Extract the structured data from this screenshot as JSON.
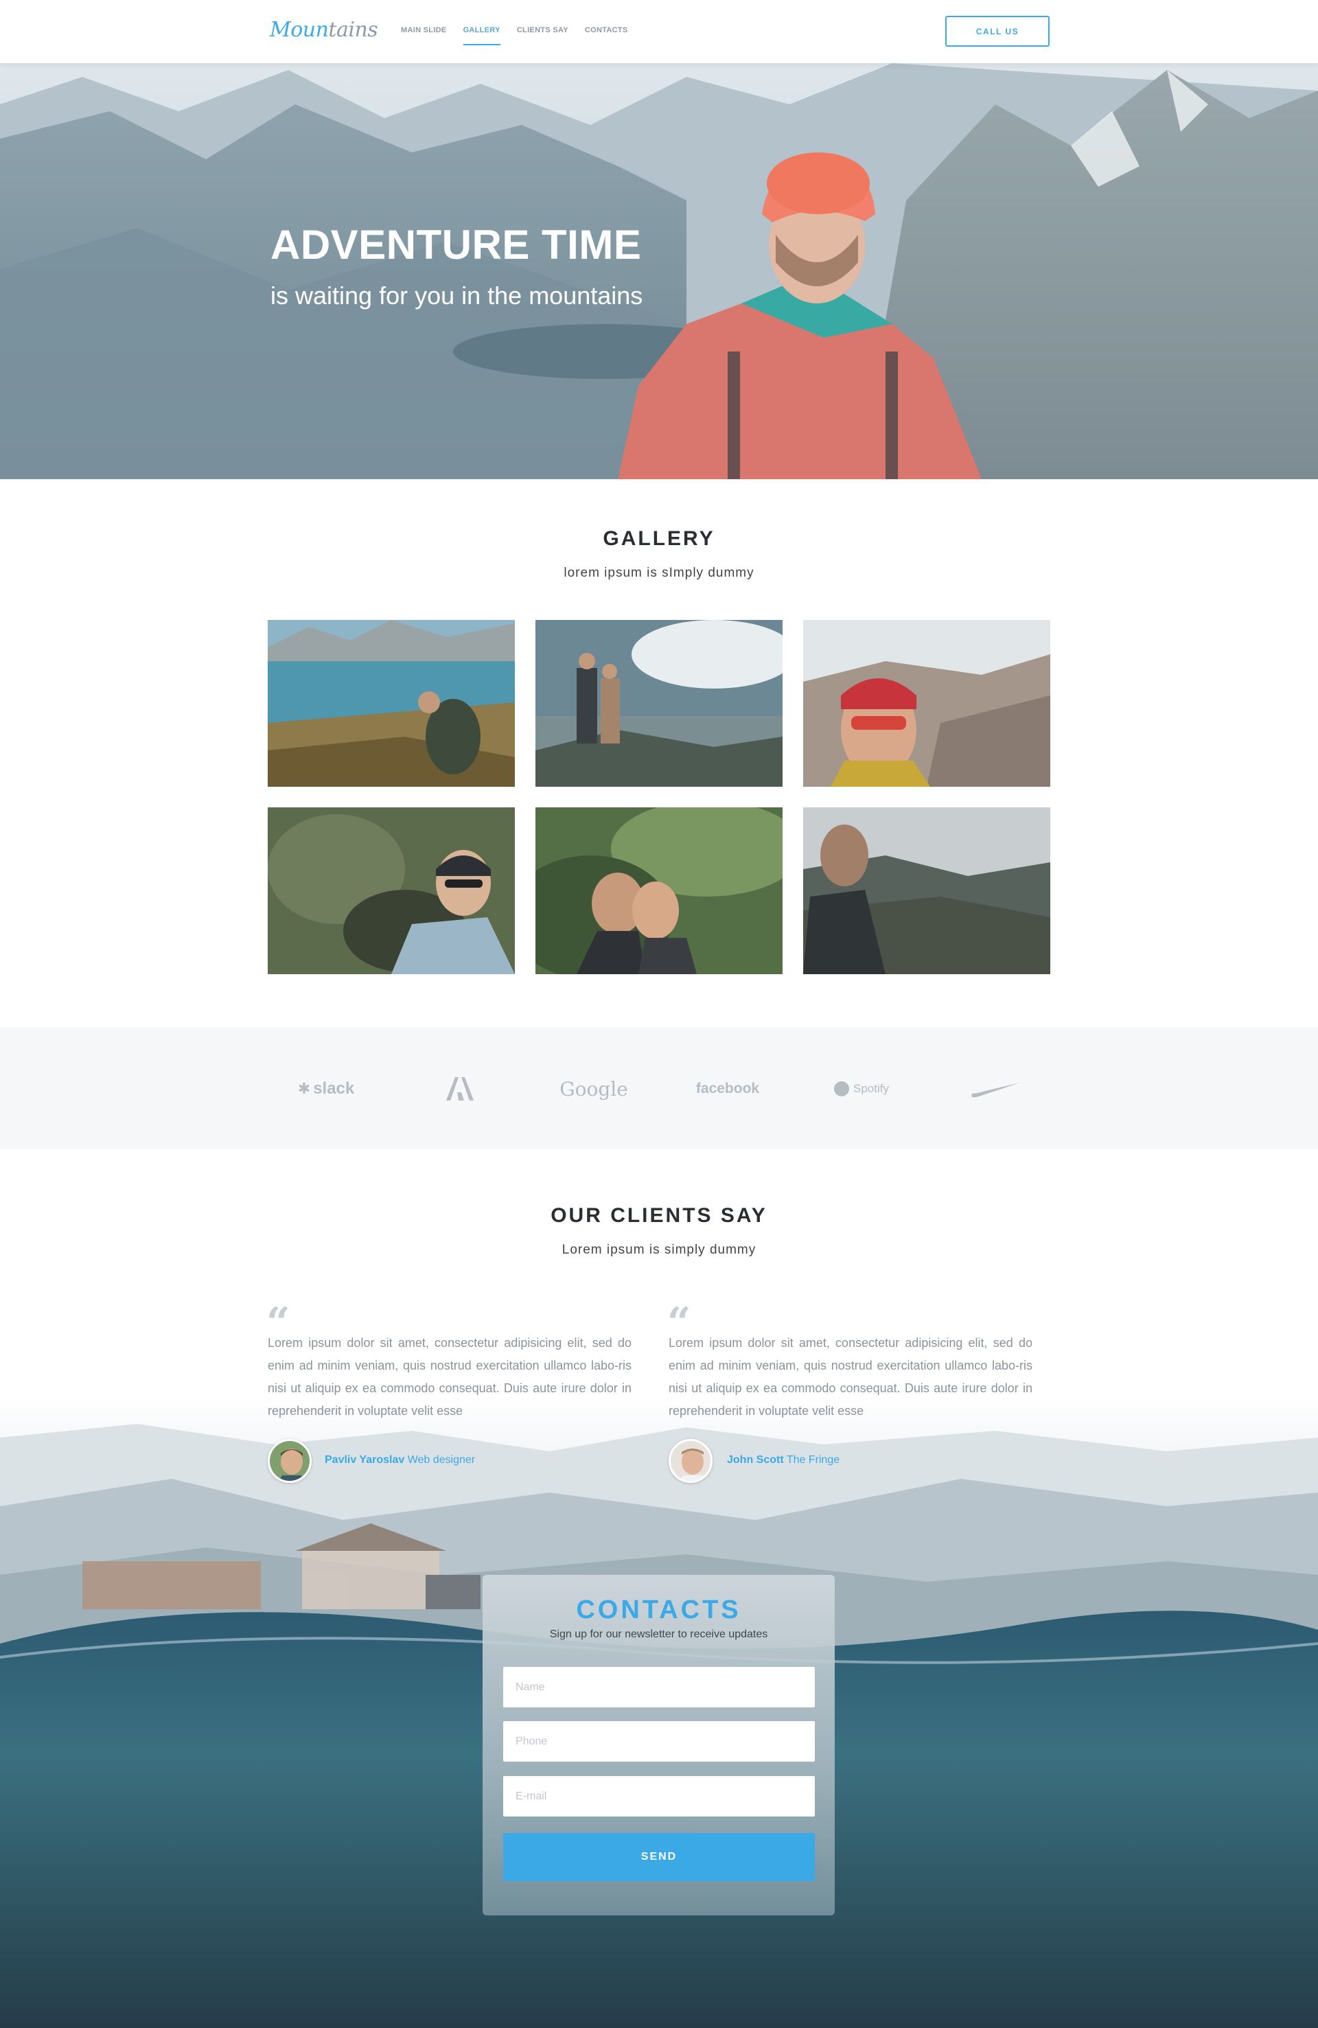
{
  "nav": {
    "logo_main": "Moun",
    "logo_tail": "tains",
    "items": [
      {
        "label": "MAIN SLIDE",
        "active": false
      },
      {
        "label": "GALLERY",
        "active": true
      },
      {
        "label": "CLIENTS SAY",
        "active": false
      },
      {
        "label": "CONTACTS",
        "active": false
      }
    ],
    "cta_label": "CALL US"
  },
  "hero": {
    "title": "ADVENTURE TIME",
    "subtitle": "is waiting for you in the mountains"
  },
  "gallery": {
    "title": "GALLERY",
    "subtitle": "lorem ipsum is sImply dummy",
    "photos": [
      {
        "name": "mountain lake hiker"
      },
      {
        "name": "couple on summit"
      },
      {
        "name": "selfie red beanie"
      },
      {
        "name": "selfie cap sunglasses"
      },
      {
        "name": "couple kissing forest"
      },
      {
        "name": "man overlooking valley"
      }
    ]
  },
  "brands": {
    "items": [
      "slack",
      "adobe",
      "Google",
      "facebook",
      "Spotify",
      "nike"
    ]
  },
  "clients": {
    "title": "OUR CLIENTS SAY",
    "subtitle": "Lorem ipsum is simply dummy",
    "testimonials": [
      {
        "text": "Lorem ipsum dolor sit amet, consectetur adipisicing elit, sed do enim ad minim veniam, quis nostrud exercitation ullamco labo-ris nisi ut aliquip ex ea commodo consequat. Duis aute irure dolor in reprehenderit in voluptate velit esse",
        "author": "Pavliv Yaroslav",
        "role": "Web designer"
      },
      {
        "text": "Lorem ipsum dolor sit amet, consectetur adipisicing elit, sed do enim ad minim veniam, quis nostrud exercitation ullamco labo-ris nisi ut aliquip ex ea commodo consequat. Duis aute irure dolor in reprehenderit in voluptate velit esse",
        "author": "John Scott",
        "role": "The Fringe"
      }
    ]
  },
  "contact": {
    "title": "CONTACTS",
    "subtitle": "Sign up for our newsletter to receive updates",
    "name_placeholder": "Name",
    "phone_placeholder": "Phone",
    "email_placeholder": "E-mail",
    "send_label": "SEND"
  },
  "colors": {
    "accent": "#3aa9e6",
    "text_dark": "#2a2e33",
    "text_muted": "#8b929a",
    "brand_gray": "#b5bcc4"
  }
}
